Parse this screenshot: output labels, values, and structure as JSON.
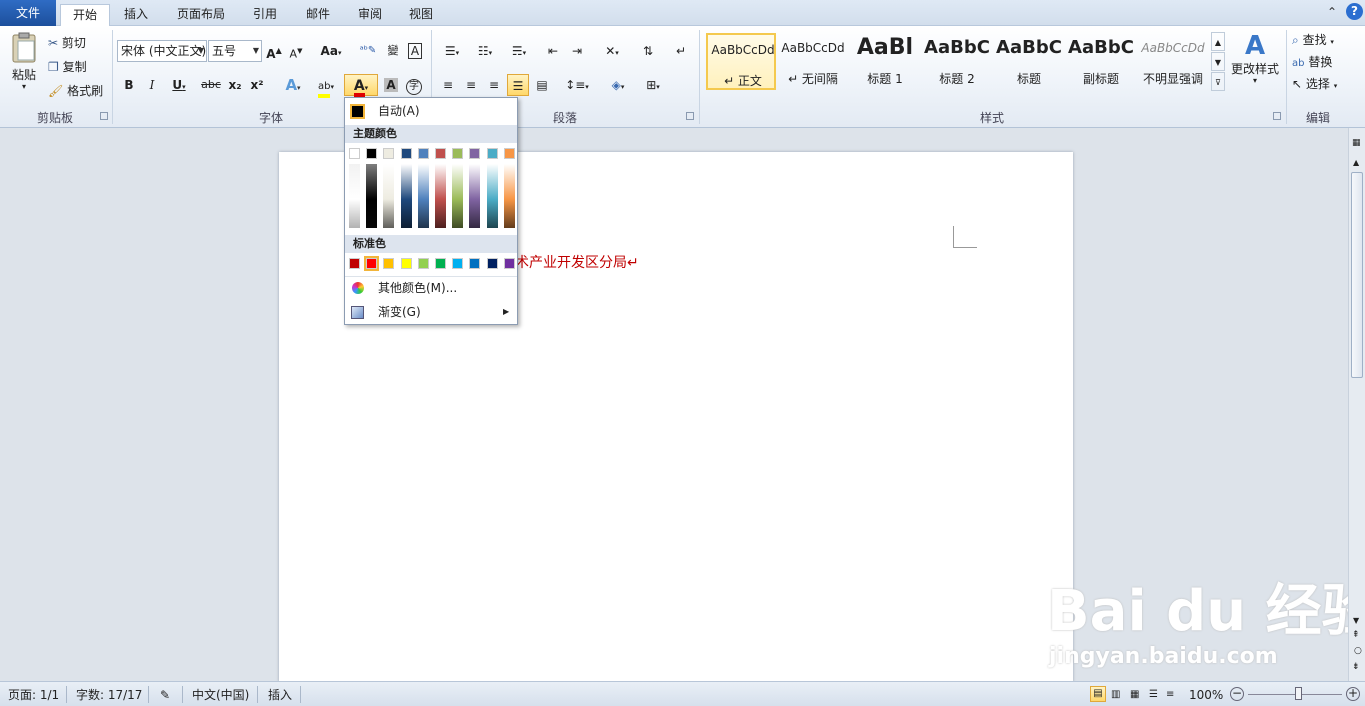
{
  "tabs": {
    "file": "文件",
    "home": "开始",
    "insert": "插入",
    "layout": "页面布局",
    "references": "引用",
    "mailings": "邮件",
    "review": "审阅",
    "view": "视图"
  },
  "clipboard": {
    "paste": "粘贴",
    "cut": "剪切",
    "copy": "复制",
    "format_painter": "格式刷",
    "label": "剪贴板"
  },
  "font": {
    "name": "宋体 (中文正文)",
    "size": "五号",
    "label": "字体",
    "bold": "B",
    "italic": "I",
    "underline": "U",
    "strike": "abc",
    "sub": "x₂",
    "sup": "x²",
    "grow": "A",
    "shrink": "A",
    "case": "Aa",
    "font_color_letter": "A",
    "font_color_value": "#e00000"
  },
  "paragraph": {
    "label": "段落"
  },
  "styles": {
    "label": "样式",
    "items": [
      {
        "sample": "AaBbCcDd",
        "name": "↵ 正文"
      },
      {
        "sample": "AaBbCcDd",
        "name": "↵ 无间隔"
      },
      {
        "sample": "AaBl",
        "name": "标题 1"
      },
      {
        "sample": "AaBbC",
        "name": "标题 2"
      },
      {
        "sample": "AaBbC",
        "name": "标题"
      },
      {
        "sample": "AaBbC",
        "name": "副标题"
      },
      {
        "sample": "AaBbCcDd",
        "name": "不明显强调"
      }
    ],
    "change": "更改样式"
  },
  "editing": {
    "find": "查找",
    "replace": "替换",
    "select": "选择",
    "label": "编辑"
  },
  "document": {
    "text": "技术产业开发区分局↵"
  },
  "color_menu": {
    "auto": "自动(A)",
    "theme_header": "主题颜色",
    "theme_colors": [
      "#ffffff",
      "#000000",
      "#eeece1",
      "#1f497d",
      "#4f81bd",
      "#c0504d",
      "#9bbb59",
      "#8064a2",
      "#4bacc6",
      "#f79646"
    ],
    "standard_header": "标准色",
    "standard_colors": [
      "#c00000",
      "#ff0000",
      "#ffc000",
      "#ffff00",
      "#92d050",
      "#00b050",
      "#00b0f0",
      "#0070c0",
      "#002060",
      "#7030a0"
    ],
    "more": "其他颜色(M)...",
    "gradient": "渐变(G)"
  },
  "status": {
    "page": "页面: 1/1",
    "words": "字数: 17/17",
    "lang": "中文(中国)",
    "mode": "插入",
    "zoom": "100%"
  },
  "watermark": {
    "brand": "Bai du 经验",
    "url": "jingyan.baidu.com"
  }
}
